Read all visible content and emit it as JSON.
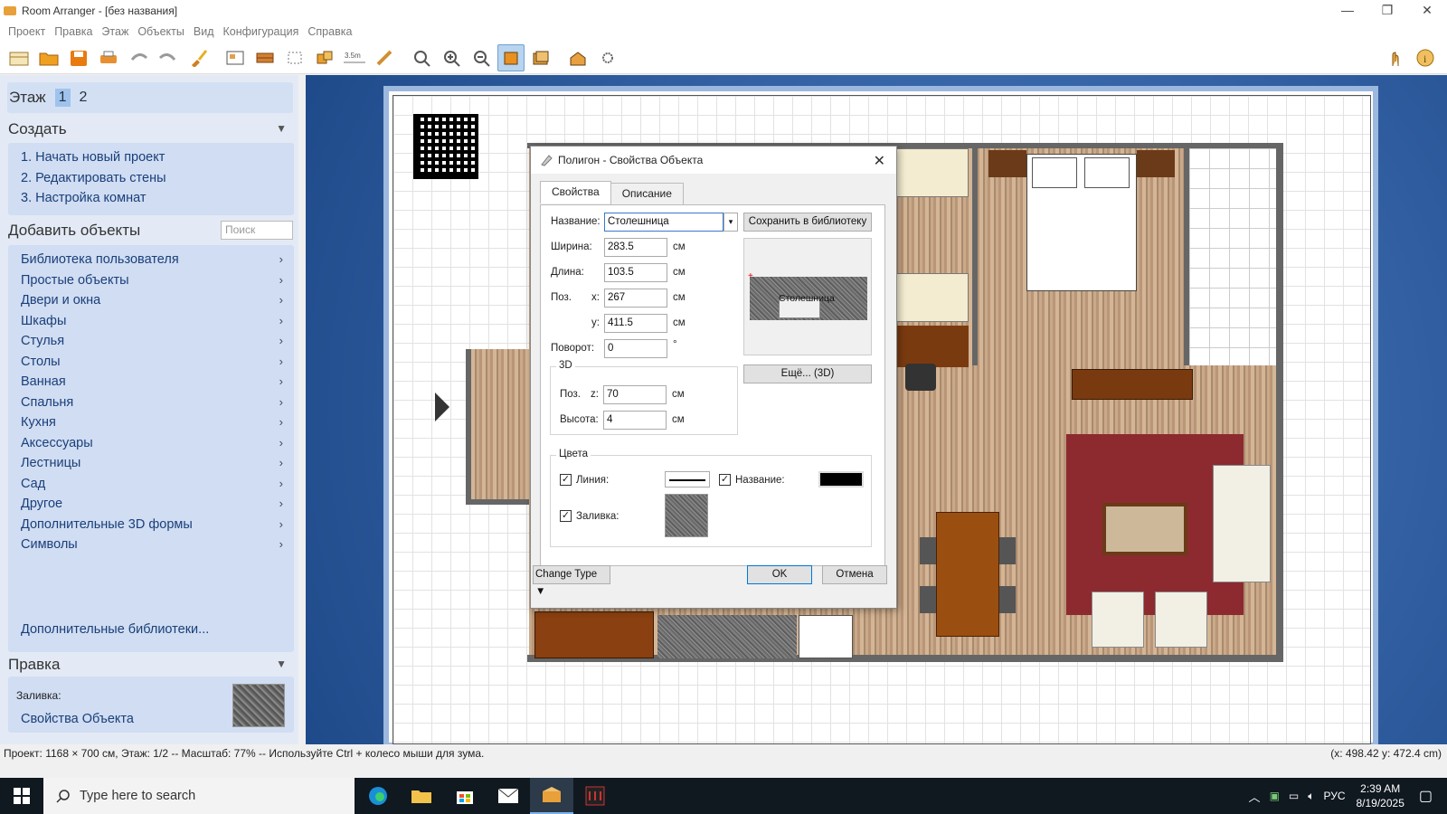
{
  "window": {
    "title": "Room Arranger - [без названия]",
    "controls": [
      "—",
      "❐",
      "✕"
    ]
  },
  "menu": [
    "Проект",
    "Правка",
    "Этаж",
    "Объекты",
    "Вид",
    "Конфигурация",
    "Справка"
  ],
  "toolbar": {
    "measure_label": "3.5m"
  },
  "sidebar": {
    "floor_label": "Этаж",
    "floors": [
      "1",
      "2"
    ],
    "create_title": "Создать",
    "create_items": [
      "1. Начать новый проект",
      "2. Редактировать стены",
      "3. Настройка комнат"
    ],
    "add_title": "Добавить объекты",
    "search_placeholder": "Поиск",
    "categories": [
      "Библиотека пользователя",
      "Простые объекты",
      "Двери и окна",
      "Шкафы",
      "Стулья",
      "Столы",
      "Ванная",
      "Спальня",
      "Кухня",
      "Аксессуары",
      "Лестницы",
      "Сад",
      "Другое",
      "Дополнительные 3D формы",
      "Символы"
    ],
    "more_libraries": "Дополнительные библиотеки...",
    "edit_title": "Правка",
    "fill_label": "Заливка:",
    "object_props": "Свойства Объекта"
  },
  "dialog": {
    "title": "Полигон - Свойства Объекта",
    "tabs": [
      "Свойства",
      "Описание"
    ],
    "name_label": "Название:",
    "name_value": "Столешница",
    "save_library": "Сохранить в библиотеку",
    "width_label": "Ширина:",
    "width_value": "283.5",
    "length_label": "Длина:",
    "length_value": "103.5",
    "pos_label": "Поз.",
    "x_label": "x:",
    "x_value": "267",
    "y_label": "y:",
    "y_value": "411.5",
    "unit": "см",
    "rotation_label": "Поворот:",
    "rotation_value": "0",
    "rotation_unit": "°",
    "group_3d": "3D",
    "z_label": "z:",
    "z_value": "70",
    "height_label": "Высота:",
    "height_value": "4",
    "preview_text": "Столешница",
    "more_3d": "Ещё... (3D)",
    "colors_group": "Цвета",
    "line_label": "Линия:",
    "name_color_label": "Название:",
    "fill_label": "Заливка:",
    "change_type": "Change Type",
    "ok": "OK",
    "cancel": "Отмена"
  },
  "status": {
    "text": "Проект: 1168 × 700 см, Этаж: 1/2 -- Масштаб: 77% -- Используйте Ctrl + колесо мыши для зума.",
    "coords": "(x: 498.42 y: 472.4 cm)"
  },
  "taskbar": {
    "search_placeholder": "Type here to search",
    "lang": "РУС",
    "time": "2:39 AM",
    "date": "8/19/2025"
  },
  "colors": {
    "accent": "#2e5fa1",
    "sidebar": "#e3eaf5",
    "panel": "#d0ddf2",
    "link": "#1a3f7a"
  }
}
